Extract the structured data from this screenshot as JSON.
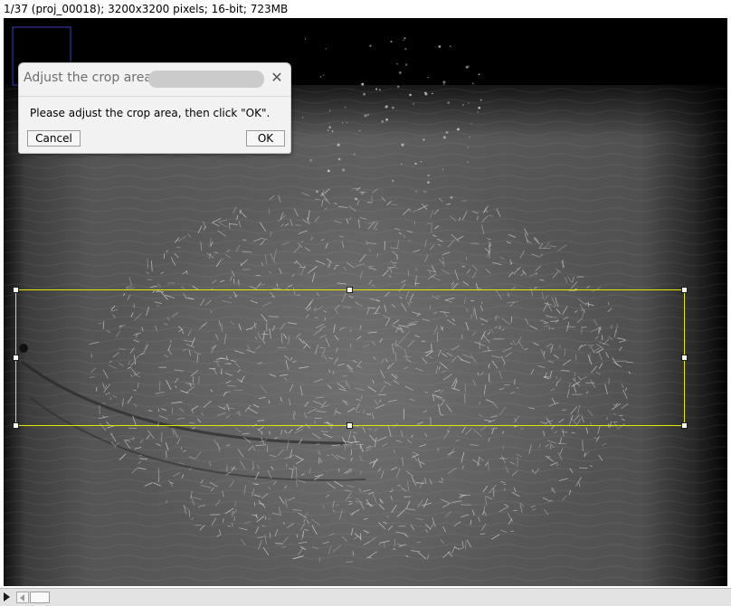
{
  "window": {
    "status_text": "1/37 (proj_00018); 3200x3200 pixels; 16-bit; 723MB"
  },
  "dialog": {
    "title": "Adjust the crop area",
    "message": "Please adjust the crop area, then click \"OK\".",
    "close_icon": "close-icon",
    "cancel_label": "Cancel",
    "ok_label": "OK"
  },
  "image": {
    "content": "grayscale microscopy stack slice with scattered bright fibres",
    "roi_color": "#e6e600"
  },
  "scrollbar": {
    "play_icon": "play-icon",
    "left_icon": "scroll-left-icon"
  }
}
